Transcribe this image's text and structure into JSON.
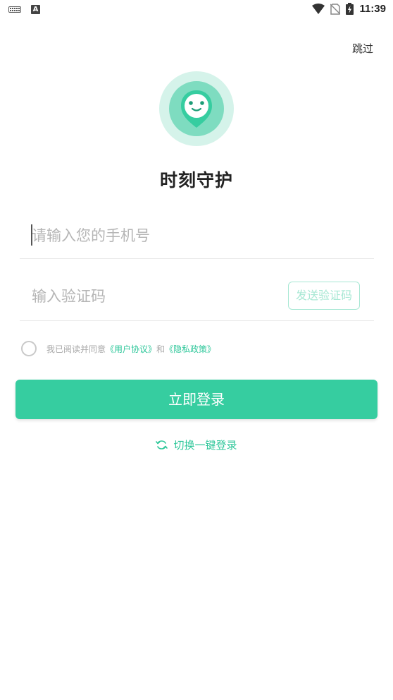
{
  "status_bar": {
    "time": "11:39",
    "left_icons": [
      "keyboard-icon",
      "a-app-icon"
    ],
    "right_icons": [
      "wifi-icon",
      "no-sim-icon",
      "battery-charging-icon"
    ],
    "a_label": "A"
  },
  "header": {
    "skip_label": "跳过"
  },
  "logo": {
    "icon": "smiley-face-icon",
    "colors": {
      "outer": "#d5f3ea",
      "middle": "#7edcc0",
      "inner": "#36cda0"
    }
  },
  "app": {
    "title": "时刻守护"
  },
  "form": {
    "phone_value": "",
    "phone_placeholder": "请输入您的手机号",
    "code_value": "",
    "code_placeholder": "输入验证码",
    "send_code_label": "发送验证码"
  },
  "agreement": {
    "checked": false,
    "prefix": "我已阅读并同意",
    "user_agreement": "《用户协议》",
    "conjunction": "和",
    "privacy_policy": "《隐私政策》"
  },
  "actions": {
    "login_label": "立即登录",
    "switch_label": "切换一键登录",
    "switch_icon": "refresh-icon"
  },
  "colors": {
    "accent": "#36cda0",
    "link": "#2ec79a",
    "placeholder": "#b5b5b5"
  }
}
